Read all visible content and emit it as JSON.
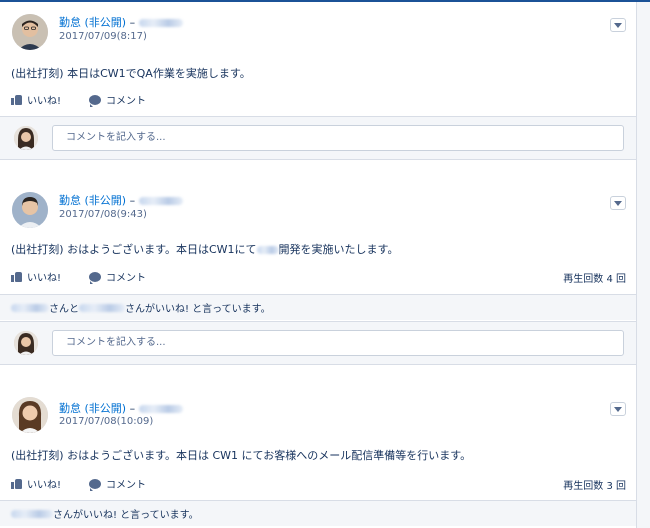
{
  "posts": [
    {
      "author": "勤怠 (非公開)",
      "separator": "–",
      "date": "2017/07/09(8:17)",
      "body": "(出社打刻) 本日はCW1でQA作業を実施します。",
      "like_label": "いいね!",
      "comment_label": "コメント",
      "views": "",
      "likes_text": "",
      "comment_placeholder": "コメントを記入する..."
    },
    {
      "author": "勤怠 (非公開)",
      "separator": "–",
      "date": "2017/07/08(9:43)",
      "body_before": "(出社打刻) おはようございます。本日はCW1にて",
      "body_after": "開発を実施いたします。",
      "like_label": "いいね!",
      "comment_label": "コメント",
      "views": "再生回数 4 回",
      "likes_mid": "さんと",
      "likes_end": "さんがいいね! と言っています。",
      "comment_placeholder": "コメントを記入する..."
    },
    {
      "author": "勤怠 (非公開)",
      "separator": "–",
      "date": "2017/07/08(10:09)",
      "body": "(出社打刻) おはようございます。本日は CW1 にてお客様へのメール配信準備等を行います。",
      "like_label": "いいね!",
      "comment_label": "コメント",
      "views": "再生回数 3 回",
      "likes_end": "さんがいいね! と言っています。"
    }
  ],
  "icons": [
    "like-icon",
    "comment-icon",
    "chevron-down-icon"
  ],
  "colors": {
    "link": "#0070d2",
    "text": "#16325c",
    "muted": "#54698d",
    "panel": "#f4f6f9"
  }
}
